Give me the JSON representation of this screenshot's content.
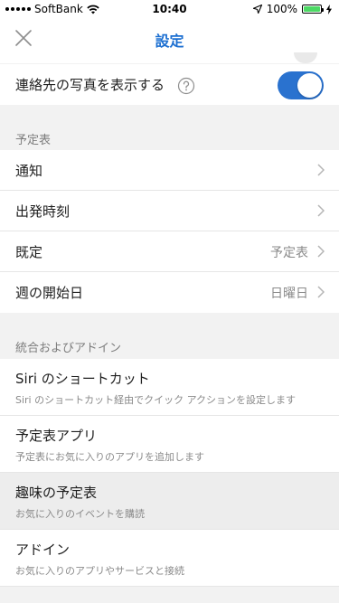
{
  "status_bar": {
    "carrier": "SoftBank",
    "time": "10:40",
    "battery_percent": "100%",
    "battery_level": 1.0,
    "colors": {
      "battery": "#4cd964"
    }
  },
  "nav": {
    "title": "設定",
    "close_icon": "close-icon",
    "accent_color": "#1c6fd1"
  },
  "contacts_photo": {
    "label": "連絡先の写真を表示する",
    "help_icon": "question-circle-icon",
    "toggle_on": true,
    "toggle_color": "#2a72cf"
  },
  "calendar_section": {
    "header": "予定表",
    "rows": [
      {
        "label": "通知",
        "value": ""
      },
      {
        "label": "出発時刻",
        "value": ""
      },
      {
        "label": "既定",
        "value": "予定表"
      },
      {
        "label": "週の開始日",
        "value": "日曜日"
      }
    ]
  },
  "integrations_section": {
    "header": "統合およびアドイン",
    "rows": [
      {
        "title": "Siri のショートカット",
        "subtitle": "Siri のショートカット経由でクイック アクションを設定します"
      },
      {
        "title": "予定表アプリ",
        "subtitle": "予定表にお気に入りのアプリを追加します"
      },
      {
        "title": "趣味の予定表",
        "subtitle": "お気に入りのイベントを購読"
      },
      {
        "title": "アドイン",
        "subtitle": "お気に入りのアプリやサービスと接続"
      }
    ]
  }
}
